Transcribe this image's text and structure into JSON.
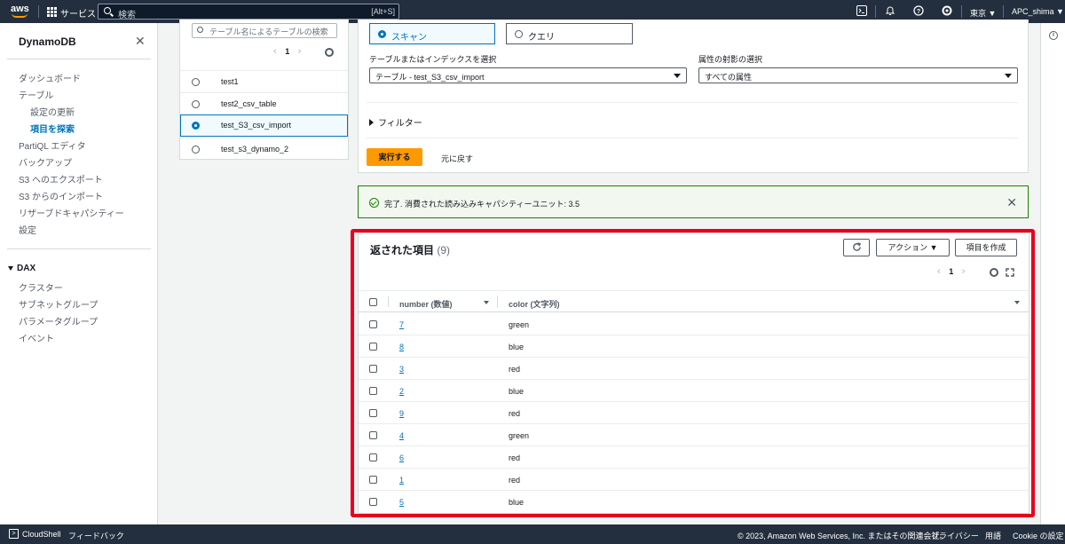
{
  "topbar": {
    "logo": "aws",
    "services_label": "サービス",
    "search_placeholder": "検索",
    "search_shortcut": "[Alt+S]",
    "region": "東京 ▼",
    "account": "APC_shima ▼",
    "icons": [
      "cloudshell-icon",
      "bell-icon",
      "help-icon",
      "settings-icon"
    ]
  },
  "sidenav": {
    "title": "DynamoDB",
    "items": [
      {
        "label": "ダッシュボード"
      },
      {
        "label": "テーブル"
      },
      {
        "label": "設定の更新"
      },
      {
        "label": "項目を探索"
      },
      {
        "label": "PartiQL エディタ"
      },
      {
        "label": "バックアップ"
      },
      {
        "label": "S3 へのエクスポート"
      },
      {
        "label": "S3 からのインポート"
      },
      {
        "label": "リザーブドキャパシティー"
      },
      {
        "label": "設定"
      }
    ],
    "dax_section": "DAX",
    "dax_items": [
      {
        "label": "クラスター"
      },
      {
        "label": "サブネットグループ"
      },
      {
        "label": "パラメータグループ"
      },
      {
        "label": "イベント"
      }
    ]
  },
  "tables_panel": {
    "search_placeholder": "テーブル名によるテーブルの検索",
    "page": "1",
    "tables": [
      {
        "name": "test1",
        "selected": false
      },
      {
        "name": "test2_csv_table",
        "selected": false
      },
      {
        "name": "test_S3_csv_import",
        "selected": true
      },
      {
        "name": "test_s3_dynamo_2",
        "selected": false
      }
    ]
  },
  "query_panel": {
    "scan_label": "スキャン",
    "query_label": "クエリ",
    "table_index_label": "テーブルまたはインデックスを選択",
    "table_index_value": "テーブル - test_S3_csv_import",
    "projection_label": "属性の射影の選択",
    "projection_value": "すべての属性",
    "filter_label": "フィルター",
    "run_label": "実行する",
    "reset_label": "元に戻す"
  },
  "flash": {
    "message": "完了. 消費された読み込みキャパシティーユニット: 3.5"
  },
  "results": {
    "title": "返された項目",
    "count": "(9)",
    "actions_label": "アクション ▼",
    "create_label": "項目を作成",
    "page": "1",
    "columns": [
      "number (数値)",
      "color (文字列)"
    ],
    "rows": [
      {
        "number": "7",
        "color": "green"
      },
      {
        "number": "8",
        "color": "blue"
      },
      {
        "number": "3",
        "color": "red"
      },
      {
        "number": "2",
        "color": "blue"
      },
      {
        "number": "9",
        "color": "red"
      },
      {
        "number": "4",
        "color": "green"
      },
      {
        "number": "6",
        "color": "red"
      },
      {
        "number": "1",
        "color": "red"
      },
      {
        "number": "5",
        "color": "blue"
      }
    ]
  },
  "footer": {
    "cloudshell": "CloudShell",
    "feedback": "フィードバック",
    "copyright": "© 2023, Amazon Web Services, Inc. またはその関連会社。",
    "privacy": "プライバシー",
    "terms": "用語",
    "cookie": "Cookie の設定"
  },
  "colors": {
    "topbar": "#232f3e",
    "primary_button": "#ff9900",
    "link": "#0073bb",
    "success": "#1d8102",
    "highlight_frame": "#e8001c"
  }
}
